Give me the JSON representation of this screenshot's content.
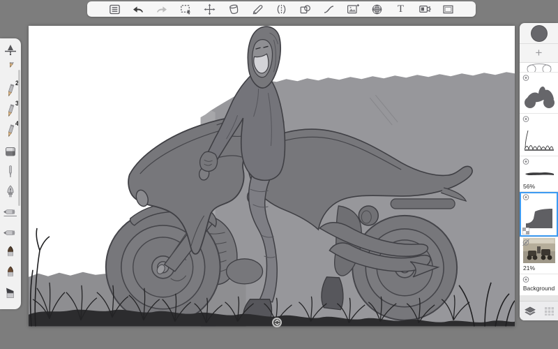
{
  "window": {
    "background_color": "#7d7d7d",
    "app": "sketch-app"
  },
  "toolbar": {
    "background_color": "#f6f6f6",
    "tools": [
      {
        "name": "menu"
      },
      {
        "name": "undo"
      },
      {
        "name": "redo"
      },
      {
        "name": "selection"
      },
      {
        "name": "transform"
      },
      {
        "name": "fill"
      },
      {
        "name": "brush"
      },
      {
        "name": "symmetry"
      },
      {
        "name": "shapes"
      },
      {
        "name": "curve"
      },
      {
        "name": "import-image"
      },
      {
        "name": "perspective"
      },
      {
        "name": "text",
        "label": "T"
      },
      {
        "name": "camera"
      },
      {
        "name": "canvas-frame"
      }
    ]
  },
  "brush_panel": {
    "brushes": [
      {
        "name": "airbrush"
      },
      {
        "name": "pencil-partial"
      },
      {
        "name": "pencil-2",
        "label": "2"
      },
      {
        "name": "pencil-3",
        "label": "3"
      },
      {
        "name": "pencil-4",
        "label": "4"
      },
      {
        "name": "eraser"
      },
      {
        "name": "ballpoint-pen"
      },
      {
        "name": "ink-nib"
      },
      {
        "name": "marker-flat-1"
      },
      {
        "name": "marker-flat-2"
      },
      {
        "name": "paint-brush-round-1"
      },
      {
        "name": "paint-brush-round-2"
      },
      {
        "name": "angled-shader"
      }
    ]
  },
  "layers_panel": {
    "current_color": "#67676b",
    "add_layer_label": "+",
    "selection_color": "#3e9bf2",
    "layers": [
      {
        "name": "sketch-partial",
        "visible": true
      },
      {
        "name": "bike-silhouette",
        "visible": true
      },
      {
        "name": "grass-sketch",
        "visible": true
      },
      {
        "name": "ground-line",
        "visible": true,
        "opacity_label": "56%"
      },
      {
        "name": "wall-shape",
        "visible": true,
        "selected": true,
        "alpha_locked": true
      },
      {
        "name": "reference-photo",
        "visible": false,
        "opacity_label": "21%"
      },
      {
        "name": "background",
        "visible": true,
        "label": "Background"
      }
    ]
  },
  "canvas": {
    "content": "grayscale sketch of hooded rider on futuristic motorcycle"
  }
}
